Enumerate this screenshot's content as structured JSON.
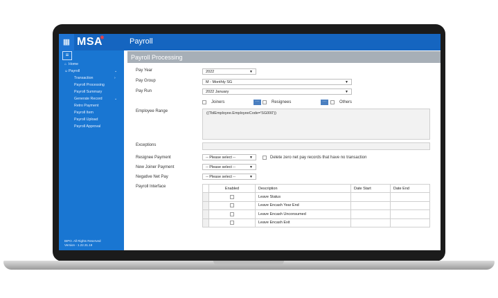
{
  "brand": {
    "logo_text": "MSA",
    "logo_mark": "✱"
  },
  "app": {
    "title": "Payroll"
  },
  "sidebar": {
    "items": [
      {
        "label": "Home",
        "icon": "home-icon"
      },
      {
        "label": "Payroll",
        "icon": "people-icon"
      },
      {
        "label": "Transaction"
      },
      {
        "label": "Payroll Processing"
      },
      {
        "label": "Payroll Summary"
      },
      {
        "label": "Generate Record"
      },
      {
        "label": "Retro Payment"
      },
      {
        "label": "Payroll Item"
      },
      {
        "label": "Payroll Upload"
      },
      {
        "label": "Payroll Approval"
      }
    ],
    "footer_line1": "BIPO. All Rights Reserved",
    "footer_line2": "Version - 1.22.31.19"
  },
  "page": {
    "title": "Payroll Processing"
  },
  "form": {
    "pay_year": {
      "label": "Pay Year",
      "value": "2022"
    },
    "pay_group": {
      "label": "Pay Group",
      "value": "M - Monthly SG"
    },
    "pay_run": {
      "label": "Pay Run",
      "value": "2022 January"
    },
    "joiners_label": "Joiners",
    "resignees_label": "Resignees",
    "others_label": "Others",
    "ellipsis": "···",
    "employee_range": {
      "label": "Employee Range",
      "value": "((TblEmployee.EmployeeCode='SG000'))"
    },
    "exceptions_label": "Exceptions",
    "resignee_payment": {
      "label": "Resignee Payment",
      "value": "-- Please select --"
    },
    "delete_zero_label": "Delete zero net pay records that have no transaction",
    "new_joiner_payment": {
      "label": "New Joiner Payment",
      "value": "-- Please select --"
    },
    "negative_net_pay": {
      "label": "Negative Net Pay",
      "value": "-- Please select --"
    },
    "payroll_interface_label": "Payroll Interface"
  },
  "interface_table": {
    "headers": [
      "Enabled",
      "Description",
      "Date Start",
      "Date End"
    ],
    "rows": [
      {
        "description": "Leave Status",
        "enabled": false
      },
      {
        "description": "Leave Encash Year End",
        "enabled": false
      },
      {
        "description": "Leave Encash Unconsumed",
        "enabled": false
      },
      {
        "description": "Leave Encash Exit",
        "enabled": false
      }
    ]
  },
  "colors": {
    "topbar": "#1565c0",
    "sidebar": "#1976d2",
    "header_bar": "#a7afb7",
    "ellipsis_button": "#4a7fc0",
    "logo_mark": "#ff3b3b"
  }
}
